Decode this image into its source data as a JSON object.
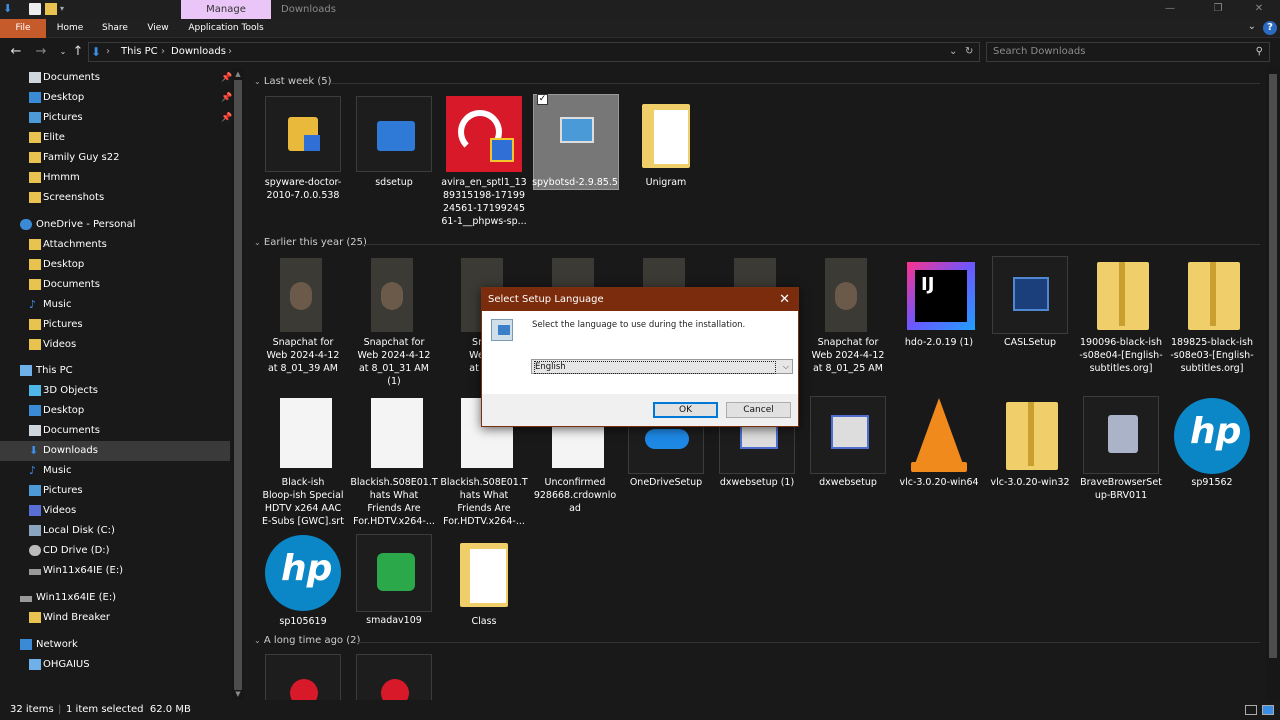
{
  "titlebar": {
    "context_tab": "Manage",
    "window_title": "Downloads"
  },
  "ribbon": {
    "tabs": [
      "File",
      "Home",
      "Share",
      "View",
      "Application Tools"
    ]
  },
  "address": {
    "crumbs": [
      "This PC",
      "Downloads"
    ],
    "search_placeholder": "Search Downloads"
  },
  "sidebar": {
    "quick_access": [
      {
        "label": "Documents",
        "pinned": true
      },
      {
        "label": "Desktop",
        "pinned": true
      },
      {
        "label": "Pictures",
        "pinned": true
      },
      {
        "label": "Elite",
        "pinned": false
      },
      {
        "label": "Family Guy s22",
        "pinned": false
      },
      {
        "label": "Hmmm",
        "pinned": false
      },
      {
        "label": "Screenshots",
        "pinned": false
      }
    ],
    "onedrive": {
      "label": "OneDrive - Personal",
      "items": [
        "Attachments",
        "Desktop",
        "Documents",
        "Music",
        "Pictures",
        "Videos"
      ]
    },
    "thispc": {
      "label": "This PC",
      "items": [
        "3D Objects",
        "Desktop",
        "Documents",
        "Downloads",
        "Music",
        "Pictures",
        "Videos",
        "Local Disk (C:)",
        "CD Drive (D:)",
        "Win11x64IE (E:)"
      ]
    },
    "drive": {
      "label": "Win11x64IE (E:)",
      "items": [
        "Wind Breaker"
      ]
    },
    "network": {
      "label": "Network",
      "items": [
        "OHGAIUS"
      ]
    }
  },
  "groups": {
    "last_week": "Last week (5)",
    "earlier": "Earlier this year (25)",
    "long_ago": "A long time ago (2)"
  },
  "files": {
    "last_week": [
      {
        "name": "spyware-doctor-2010-7.0.0.538",
        "lines": [
          "spyware-doctor-",
          "2010-7.0.0.538"
        ],
        "icon": "installer-icon"
      },
      {
        "name": "sdsetup",
        "lines": [
          "sdsetup"
        ],
        "icon": "installer-icon"
      },
      {
        "name": "avira",
        "lines": [
          "avira_en_sptl1_13",
          "89315198-17199",
          "24561-17199245",
          "61-1__phpws-sp..."
        ],
        "icon": "avira-icon"
      },
      {
        "name": "spybotsd-2.9.85.5",
        "lines": [
          "spybotsd-2.9.85.5"
        ],
        "icon": "installer-icon"
      },
      {
        "name": "Unigram",
        "lines": [
          "Unigram"
        ],
        "icon": "folder-icon"
      }
    ],
    "earlier_row1": [
      {
        "lines": [
          "Snapchat for",
          "Web 2024-4-12",
          "at 8_01_39 AM"
        ]
      },
      {
        "lines": [
          "Snapchat for",
          "Web 2024-4-12",
          "at 8_01_31 AM",
          "(1)"
        ]
      },
      {
        "lines": [
          "Snap",
          "Web 2",
          "at 8_0"
        ]
      },
      {
        "lines": [
          ""
        ]
      },
      {
        "lines": [
          ""
        ]
      },
      {
        "lines": [
          ""
        ]
      },
      {
        "lines": [
          "Snapchat for",
          "Web 2024-4-12",
          "at 8_01_25 AM"
        ]
      },
      {
        "lines": [
          "hdo-2.0.19 (1)"
        ]
      },
      {
        "lines": [
          "CASLSetup"
        ]
      },
      {
        "lines": [
          "190096-black-ish",
          "-s08e04-[English-",
          "subtitles.org]"
        ]
      },
      {
        "lines": [
          "189825-black-ish",
          "-s08e03-[English-",
          "subtitles.org]"
        ]
      }
    ],
    "earlier_row2": [
      {
        "lines": [
          "Black-ish",
          "Bloop-ish Special",
          "HDTV x264 AAC",
          "E-Subs [GWC].srt"
        ]
      },
      {
        "lines": [
          "Blackish.S08E01.T",
          "hats What",
          "Friends Are",
          "For.HDTV.x264-..."
        ]
      },
      {
        "lines": [
          "Blackish.S08E01.T",
          "hats What",
          "Friends Are",
          "For.HDTV.x264-..."
        ]
      },
      {
        "lines": [
          "Unconfirmed",
          "928668.crdownlo",
          "ad"
        ]
      },
      {
        "lines": [
          "OneDriveSetup"
        ]
      },
      {
        "lines": [
          "dxwebsetup (1)"
        ]
      },
      {
        "lines": [
          "dxwebsetup"
        ]
      },
      {
        "lines": [
          "vlc-3.0.20-win64"
        ]
      },
      {
        "lines": [
          "vlc-3.0.20-win32"
        ]
      },
      {
        "lines": [
          "BraveBrowserSet",
          "up-BRV011"
        ]
      },
      {
        "lines": [
          "sp91562"
        ]
      }
    ],
    "earlier_row3": [
      {
        "lines": [
          "sp105619"
        ]
      },
      {
        "lines": [
          "smadav109"
        ]
      },
      {
        "lines": [
          "Class"
        ]
      }
    ]
  },
  "status": {
    "count": "32 items",
    "selection": "1 item selected  62.0 MB"
  },
  "dialog": {
    "title": "Select Setup Language",
    "message": "Select the language to use during the installation.",
    "selected_language": "English",
    "ok": "OK",
    "cancel": "Cancel"
  }
}
